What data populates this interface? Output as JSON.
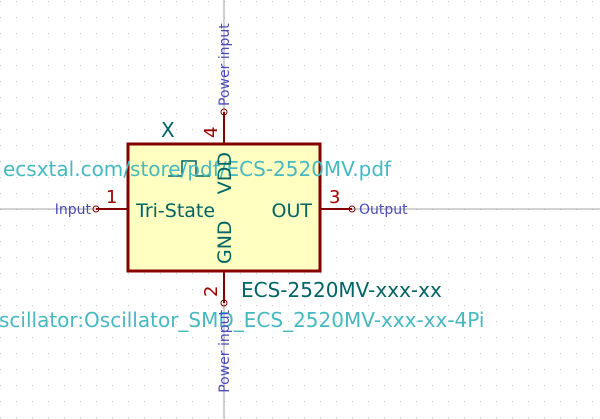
{
  "symbol": {
    "reference": "X",
    "value": "ECS-2520MV-xxx-xx",
    "footprint": "scillator:Oscillator_SMD_ECS_2520MV-xxx-xx-4Pi",
    "datasheet": "ecsxtal.com/store/pdf/ECS-2520MV.pdf"
  },
  "pins": [
    {
      "number": "1",
      "name": "Tri-State",
      "type": "Input"
    },
    {
      "number": "2",
      "name": "GND",
      "type": "Power input"
    },
    {
      "number": "3",
      "name": "OUT",
      "type": "Output"
    },
    {
      "number": "4",
      "name": "VDD",
      "type": "Power input"
    }
  ],
  "colors": {
    "background": "#ffffff",
    "grid_dot": "#c8c8c8",
    "body_fill": "#ffffc2",
    "body_stroke": "#840000",
    "pin_line": "#840000",
    "pin_number": "#a00000",
    "pin_name": "#006464",
    "pin_type": "#4a4ab8",
    "field_reference": "#006464",
    "field_value": "#006464",
    "field_hidden": "#48b8c0"
  }
}
